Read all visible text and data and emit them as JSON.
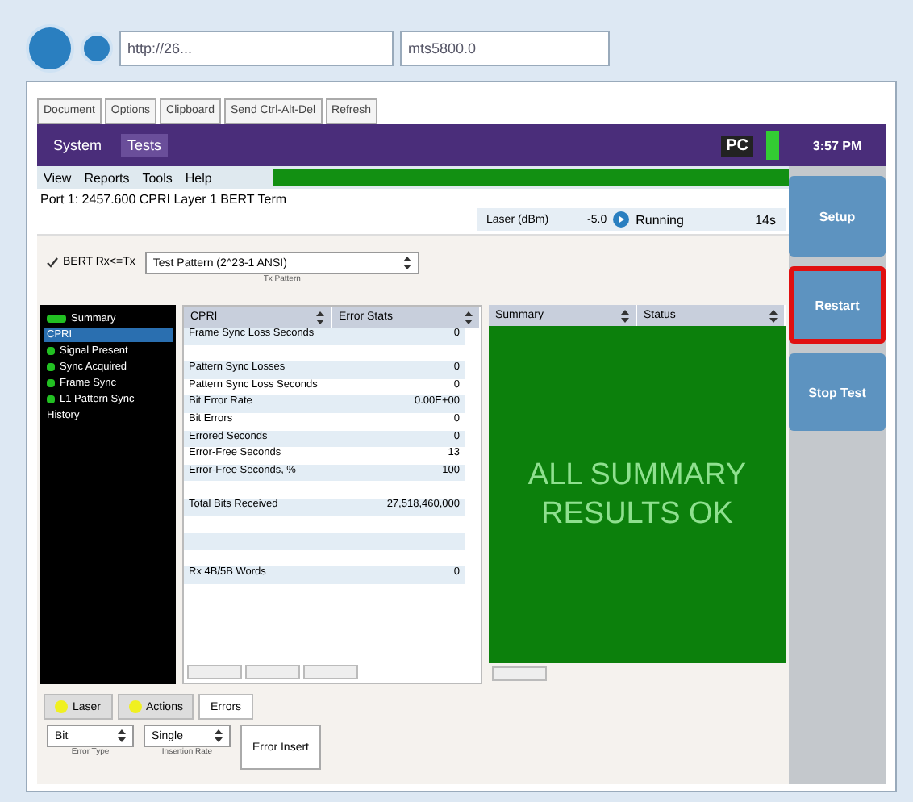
{
  "browser": {
    "address": "http://26...",
    "tab_title": "mts5800.0"
  },
  "page_tabs": [
    "Document",
    "Options",
    "Clipboard",
    "Send Ctrl-Alt-Del",
    "Refresh"
  ],
  "top_bar": {
    "items": [
      {
        "label": "System",
        "selected": false
      },
      {
        "label": "Tests",
        "selected": true
      }
    ],
    "badge": "PC",
    "time": "3:57 PM"
  },
  "menu": [
    "View",
    "Reports",
    "Tools",
    "Help"
  ],
  "status": {
    "port": "Port 1: 2457.600 CPRI Layer 1 BERT Term",
    "laser_label": "Laser (dBm)",
    "laser_value": "-5.0",
    "state": "Running",
    "elapsed": "14s"
  },
  "side_buttons": [
    {
      "label": "Setup",
      "highlighted": false
    },
    {
      "label": "Restart",
      "highlighted": true
    },
    {
      "label": "Stop Test",
      "highlighted": false
    }
  ],
  "bert": {
    "label": "BERT Rx<=Tx",
    "checked": true,
    "pattern": "Test Pattern (2^23-1 ANSI)",
    "pattern_caption": "Tx Pattern"
  },
  "tree": [
    {
      "label": "Summary",
      "selected": false,
      "color": "#22c022"
    },
    {
      "label": "CPRI",
      "selected": true
    },
    {
      "label": "Signal Present",
      "selected": false,
      "color": "#22c022"
    },
    {
      "label": "Sync Acquired",
      "selected": false,
      "color": "#22c022"
    },
    {
      "label": "Frame Sync",
      "selected": false,
      "color": "#22c022"
    },
    {
      "label": "L1 Pattern Sync",
      "selected": false,
      "color": "#22c022"
    },
    {
      "label": "History",
      "selected": false
    }
  ],
  "stats": {
    "headers": [
      "CPRI",
      "Error Stats"
    ],
    "rows": [
      {
        "name": "Frame Sync Loss Seconds",
        "value": "0"
      },
      {
        "name": "",
        "value": ""
      },
      {
        "name": "Pattern Sync Losses",
        "value": "0"
      },
      {
        "name": "Pattern Sync Loss Seconds",
        "value": "0"
      },
      {
        "name": "Bit Error Rate",
        "value": "0.00E+00"
      },
      {
        "name": "Bit Errors",
        "value": "0"
      },
      {
        "name": "Errored Seconds",
        "value": "0"
      },
      {
        "name": "Error-Free Seconds",
        "value": "13"
      },
      {
        "name": "Error-Free Seconds, %",
        "value": "100"
      },
      {
        "name": "",
        "value": ""
      },
      {
        "name": "Total Bits Received",
        "value": "27,518,460,000"
      },
      {
        "name": "",
        "value": ""
      },
      {
        "name": "",
        "value": ""
      },
      {
        "name": "",
        "value": ""
      },
      {
        "name": "Rx 4B/5B Words",
        "value": "0"
      }
    ]
  },
  "summary": {
    "headers": [
      "Summary",
      "Status"
    ],
    "message": "ALL SUMMARY RESULTS OK"
  },
  "bottom_tabs": [
    {
      "label": "Laser",
      "selected": false,
      "color": "#f0f020"
    },
    {
      "label": "Actions",
      "selected": false,
      "color": "#f0f020"
    },
    {
      "label": "Errors",
      "selected": true
    }
  ],
  "errors": {
    "type": "Bit",
    "type_caption": "Error Type",
    "rate": "Single",
    "rate_caption": "Insertion Rate",
    "button": "Error Insert"
  }
}
